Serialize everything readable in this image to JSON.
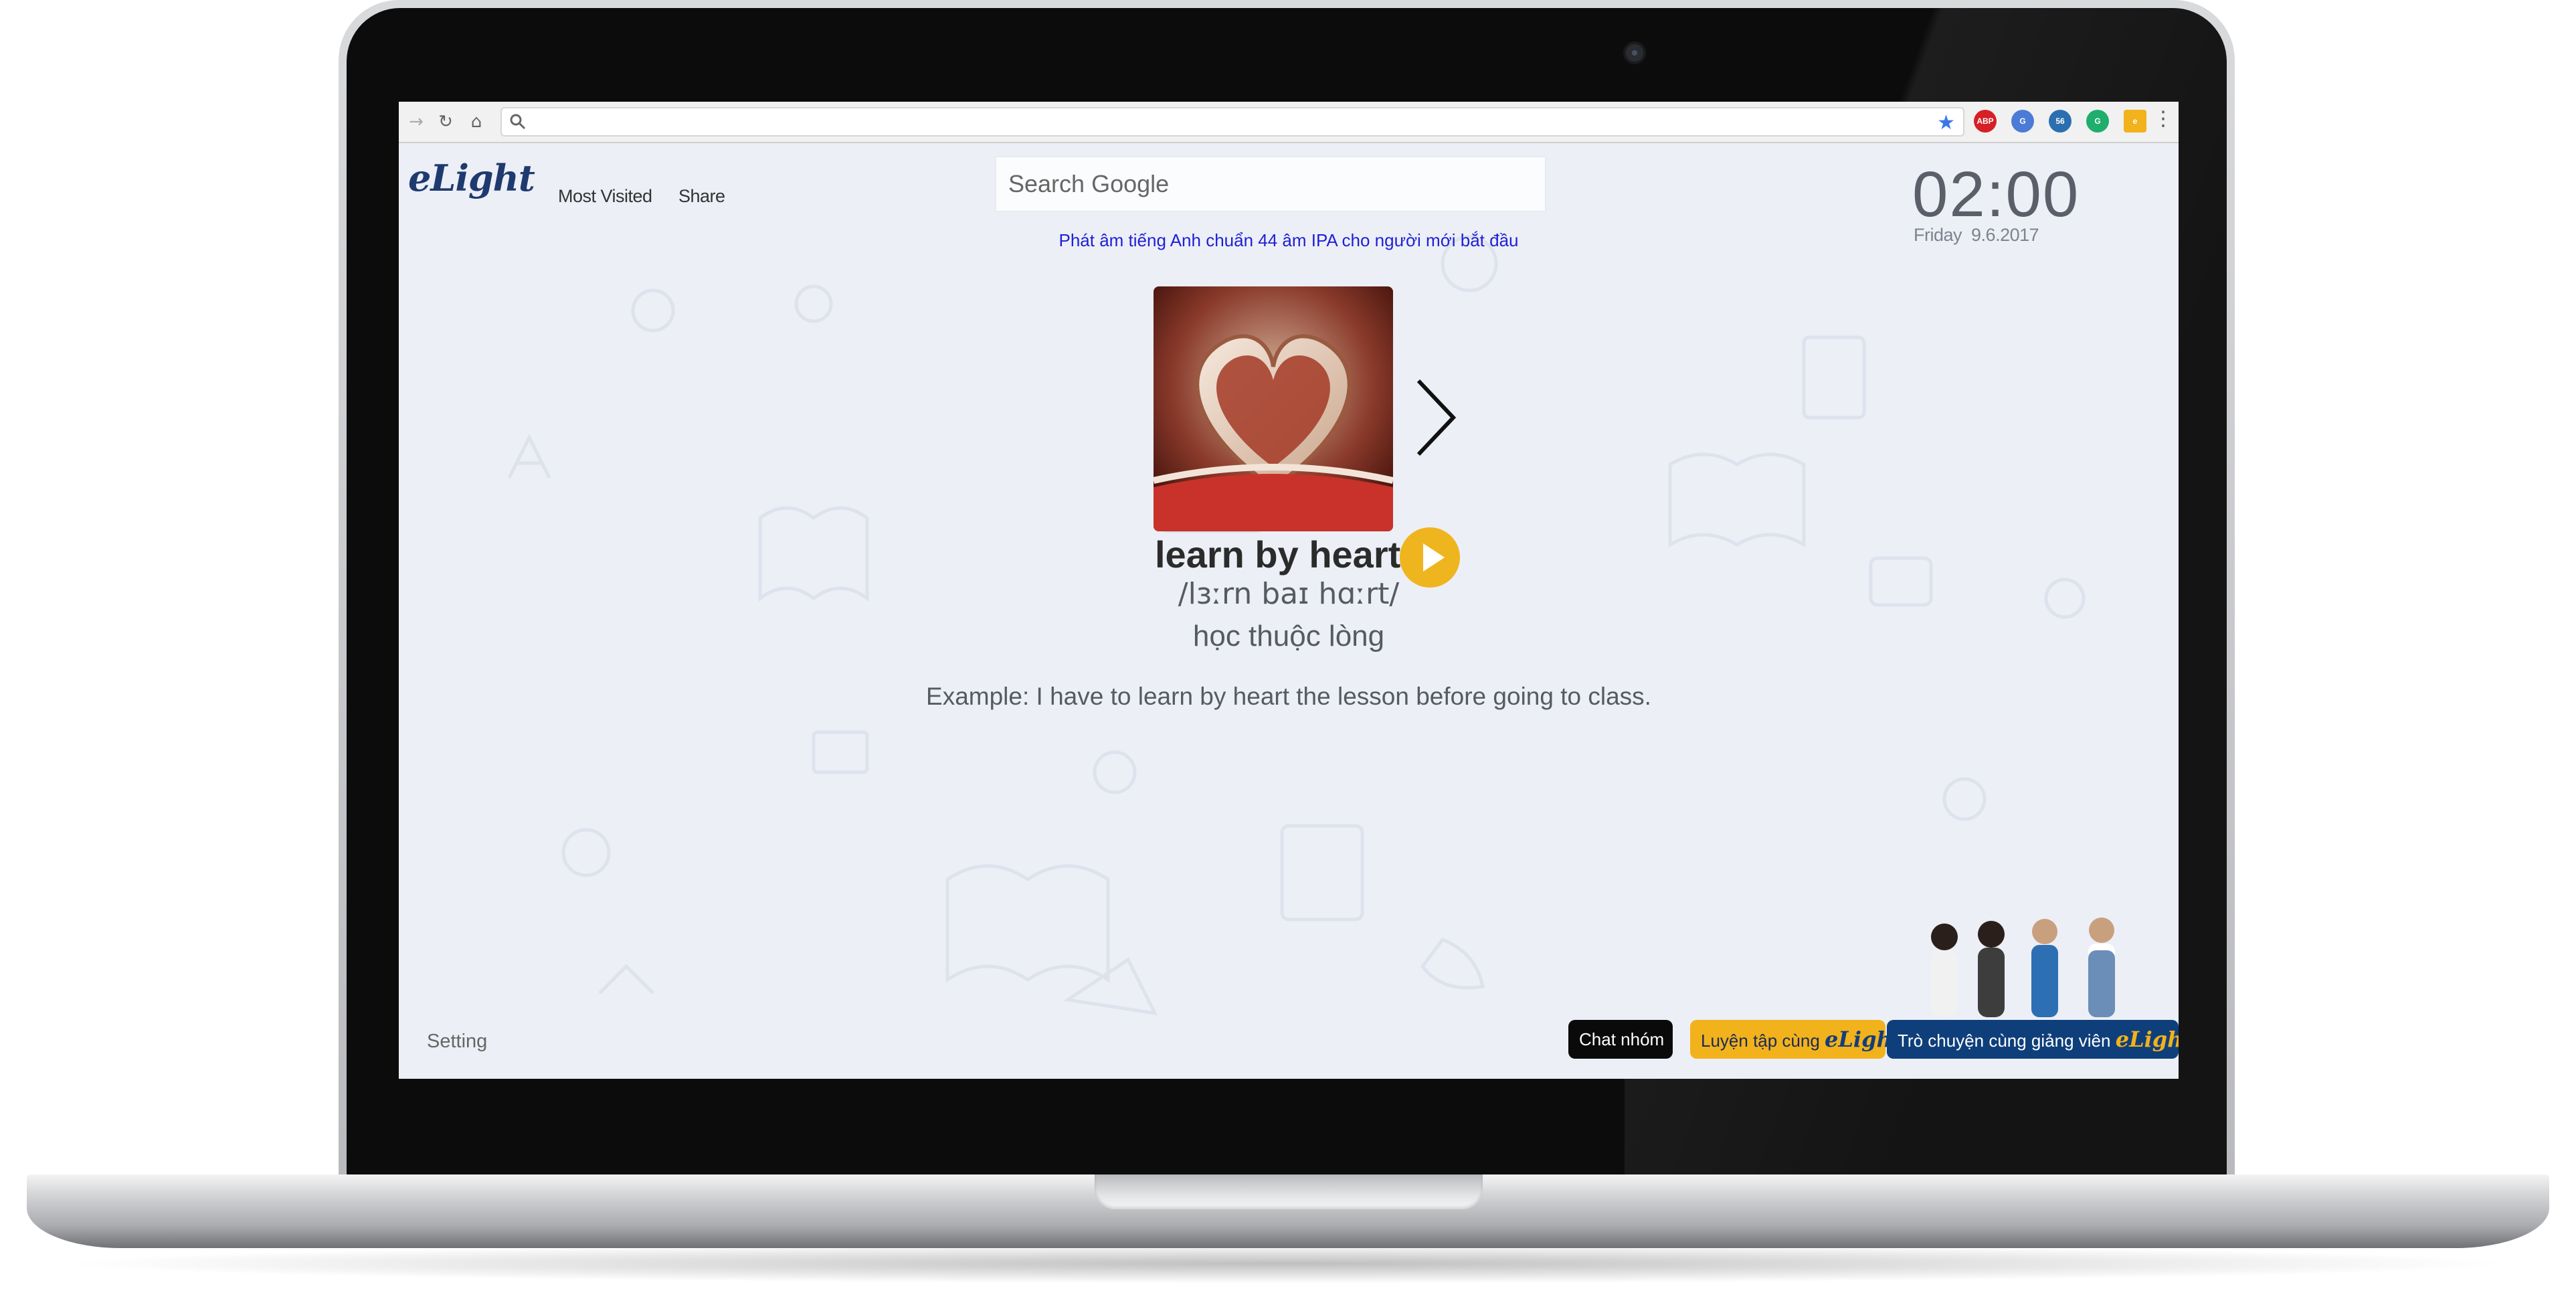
{
  "browser": {
    "address_value": "",
    "extensions": [
      "ABP",
      "G",
      "56",
      "G",
      "e"
    ]
  },
  "header": {
    "logo_text": "eLight",
    "nav": [
      "Most Visited",
      "Share"
    ],
    "search_placeholder": "Search Google",
    "promo_link": "Phát âm tiếng Anh chuẩn 44 âm IPA cho người mới bắt đầu",
    "clock_time": "02:00",
    "clock_day": "Friday",
    "clock_date": "9.6.2017"
  },
  "flashcard": {
    "word": "learn by heart",
    "ipa": "/lɜːrn baɪ hɑːrt/",
    "meaning": "học thuộc lòng",
    "example": "Example: I have to learn by heart the lesson before going to class."
  },
  "footer": {
    "setting_label": "Setting",
    "chat_group_label": "Chat nhóm",
    "practice_label": "Luyện tập cùng",
    "teacher_label": "Trò chuyện cùng giảng viên",
    "brand": "eLight"
  },
  "colors": {
    "accent_yellow": "#efb51e",
    "brand_navy": "#0f3f7a",
    "link_blue": "#1f1fd6",
    "page_bg": "#eceff6"
  },
  "icons": {
    "back": "arrow-right-icon",
    "reload": "reload-icon",
    "home": "home-icon",
    "search": "search-icon",
    "bookmark": "star-icon",
    "menu": "more-vertical-icon",
    "next": "chevron-right-icon",
    "audio": "play-icon"
  }
}
